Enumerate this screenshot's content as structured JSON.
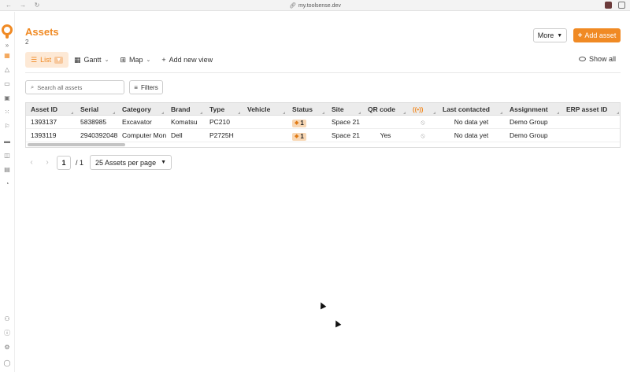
{
  "browser": {
    "url": "my.toolsense.dev"
  },
  "sidebar": {
    "icons": [
      "logo",
      "expand-icon",
      "assets-icon",
      "alerts-icon",
      "inbox-icon",
      "inventory-icon",
      "qr-icon",
      "flag-icon",
      "vehicle-icon",
      "reports-icon",
      "documents-icon",
      "timer-icon",
      "users-icon",
      "help-icon",
      "settings-icon",
      "profile-icon"
    ]
  },
  "header": {
    "title": "Assets",
    "count": "2",
    "more_label": "More",
    "add_label": "Add asset"
  },
  "views": {
    "items": [
      {
        "label": "List",
        "active": true
      },
      {
        "label": "Gantt",
        "active": false
      },
      {
        "label": "Map",
        "active": false
      }
    ],
    "add_view_label": "Add new view",
    "show_all_label": "Show all"
  },
  "search": {
    "placeholder": "Search all assets"
  },
  "filters_label": "Filters",
  "table": {
    "columns": [
      "Asset ID",
      "Serial",
      "Category",
      "Brand",
      "Type",
      "Vehicle",
      "Status",
      "Site",
      "QR code",
      "",
      "Last contacted",
      "Assignment",
      "ERP asset ID"
    ],
    "rows": [
      {
        "asset_id": "1393137",
        "serial": "5838985",
        "category": "Excavator",
        "brand": "Komatsu",
        "type": "PC210",
        "vehicle": "",
        "status": "1",
        "site": "Space 21",
        "qr": "",
        "last_contacted": "No data yet",
        "assignment": "Demo Group",
        "erp": ""
      },
      {
        "asset_id": "1393119",
        "serial": "2940392048",
        "category": "Computer Monitor",
        "brand": "Dell",
        "type": "P2725H",
        "vehicle": "",
        "status": "1",
        "site": "Space 21",
        "qr": "Yes",
        "last_contacted": "No data yet",
        "assignment": "Demo Group",
        "erp": ""
      }
    ]
  },
  "pagination": {
    "page": "1",
    "total": "/ 1",
    "per_page": "25 Assets per page"
  },
  "colors": {
    "accent": "#f08a24"
  }
}
